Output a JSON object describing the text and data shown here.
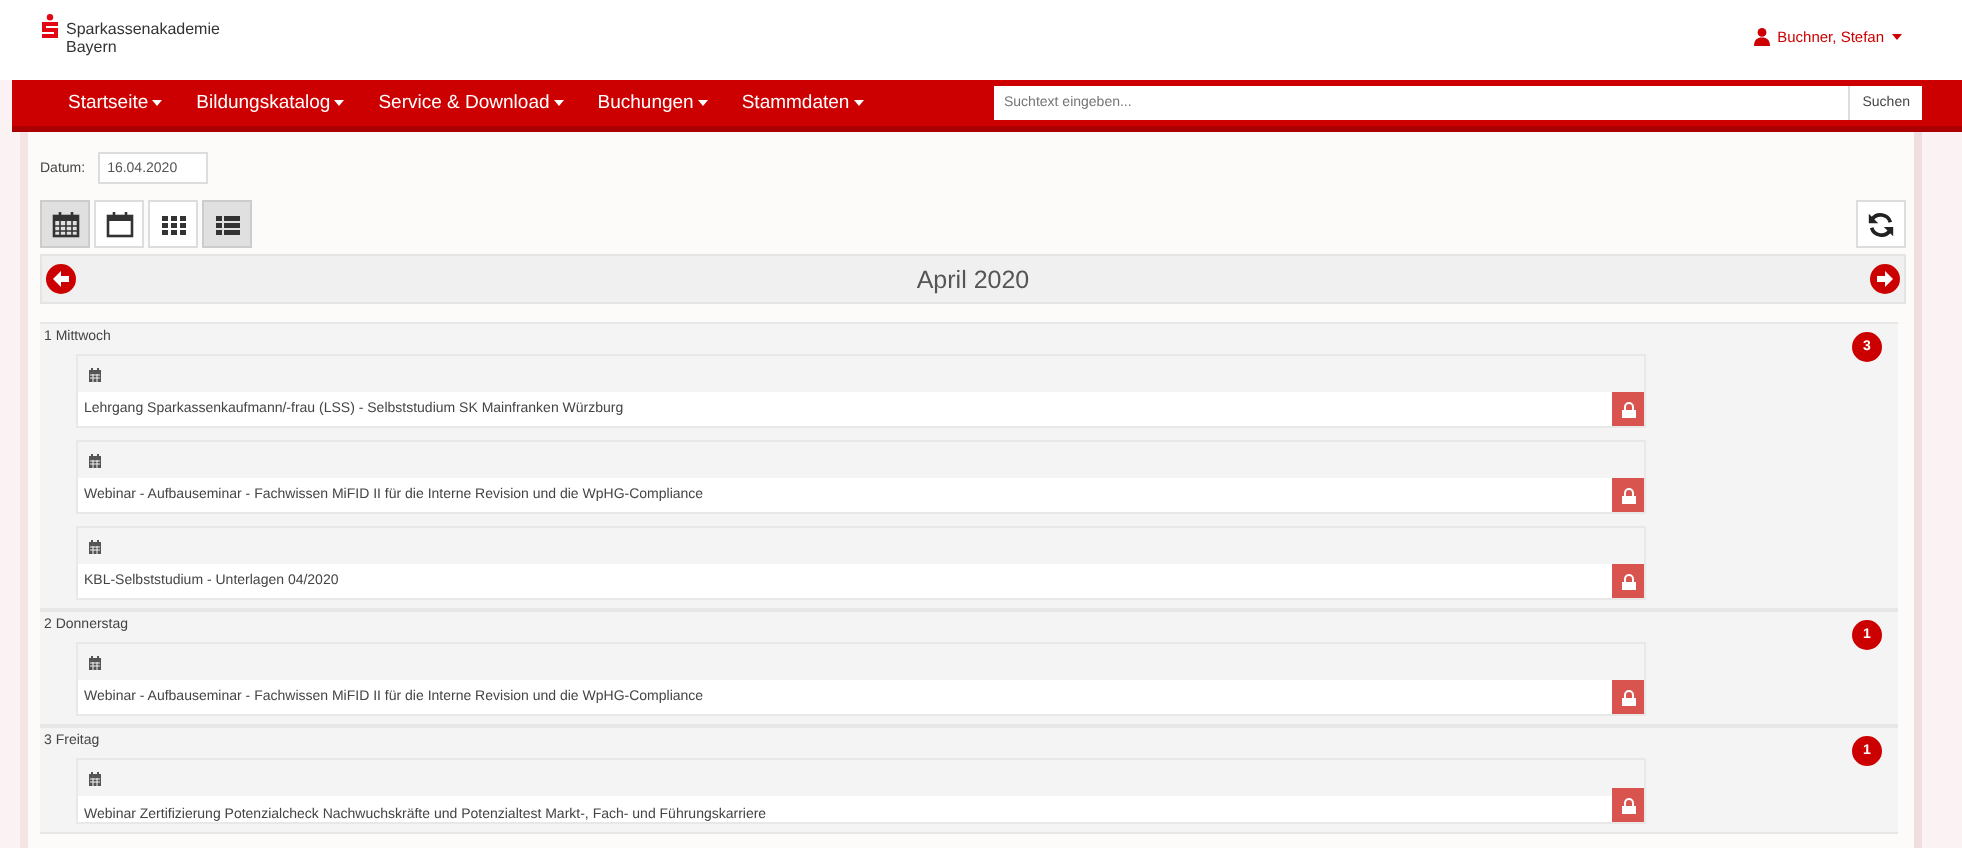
{
  "header": {
    "logo_lines": [
      "Sparkassenakademie",
      "Bayern"
    ],
    "user": "Buchner, Stefan"
  },
  "nav": {
    "items": [
      {
        "label": "Startseite"
      },
      {
        "label": "Bildungskatalog"
      },
      {
        "label": "Service & Download"
      },
      {
        "label": "Buchungen"
      },
      {
        "label": "Stammdaten"
      }
    ],
    "search": {
      "placeholder": "Suchtext eingeben..."
    },
    "search_button": "Suchen"
  },
  "date_filter": {
    "label": "Datum:",
    "value": "16.04.2020"
  },
  "view_buttons": [
    {
      "kind": "month",
      "selected": true
    },
    {
      "kind": "day",
      "selected": false
    },
    {
      "kind": "grid",
      "selected": false
    },
    {
      "kind": "list",
      "selected": true
    }
  ],
  "calendar": {
    "title": "April 2020",
    "days": [
      {
        "label": "1 Mittwoch",
        "count": "3",
        "events": [
          {
            "title": "Lehrgang Sparkassenkaufmann/-frau (LSS) - Selbststudium SK Mainfranken Würzburg",
            "locked": true
          },
          {
            "title": "Webinar - Aufbauseminar - Fachwissen MiFID II für die Interne Revision und die WpHG-Compliance",
            "locked": true
          },
          {
            "title": "KBL-Selbststudium - Unterlagen 04/2020",
            "locked": true
          }
        ]
      },
      {
        "label": "2 Donnerstag",
        "count": "1",
        "events": [
          {
            "title": "Webinar - Aufbauseminar - Fachwissen MiFID II für die Interne Revision und die WpHG-Compliance",
            "locked": true
          }
        ]
      },
      {
        "label": "3 Freitag",
        "count": "1",
        "events": [
          {
            "title": "Webinar Zertifizierung Potenzialcheck Nachwuchskräfte und Potenzialtest Markt-, Fach- und Führungskarriere",
            "locked": true
          }
        ]
      }
    ]
  }
}
